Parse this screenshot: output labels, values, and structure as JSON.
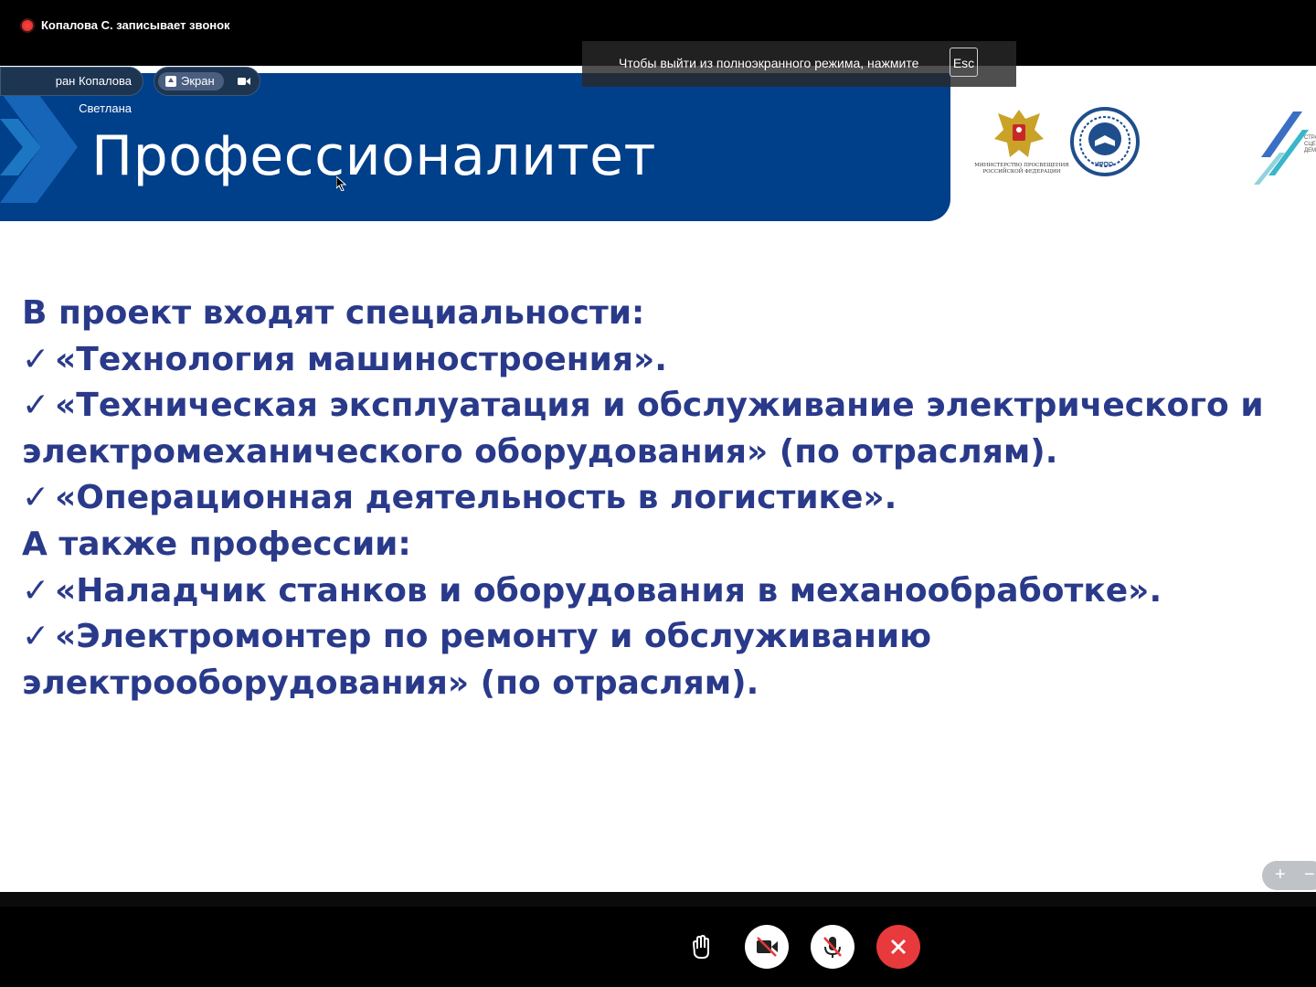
{
  "recording": {
    "text": "Копалова С. записывает звонок"
  },
  "fullscreen_notice": {
    "text": "Чтобы выйти из полноэкранного режима, нажмите",
    "key": "Esc"
  },
  "participant": {
    "label": "ран Копалова Светлана"
  },
  "screen_share": {
    "label": "Экран"
  },
  "slide": {
    "title": "Профессионалитет",
    "ministry_caption": "Министерство просвещения Российской Федерации",
    "irpo_caption": "ИРПО",
    "strat_caption": "СТРА СЦЕН ДЕМО",
    "lines": [
      {
        "check": false,
        "text": "В проект входят специальности:"
      },
      {
        "check": true,
        "text": "«Технология машиностроения»."
      },
      {
        "check": true,
        "text": "«Техническая эксплуатация и обслуживание электрического и"
      },
      {
        "check": false,
        "text": "электромеханического оборудования» (по отраслям)."
      },
      {
        "check": true,
        "text": "«Операционная деятельность в логистике»."
      },
      {
        "check": false,
        "text": "А также профессии:"
      },
      {
        "check": true,
        "text": "«Наладчик станков и оборудования в механообработке»."
      },
      {
        "check": true,
        "text": "«Электромонтер по ремонту и обслуживанию"
      },
      {
        "check": false,
        "text": "электрооборудования» (по отраслям)."
      }
    ],
    "check_mark": "✓"
  },
  "zoom": {
    "plus": "+",
    "minus": "−"
  },
  "controls": {
    "raise_hand": "hand-icon",
    "camera": "camera-off-icon",
    "microphone": "mic-off-icon",
    "end_call": "close-icon"
  },
  "colors": {
    "banner": "#003f8a",
    "text": "#2a3a8a",
    "end_call": "#e8393c",
    "record": "#e53935"
  }
}
